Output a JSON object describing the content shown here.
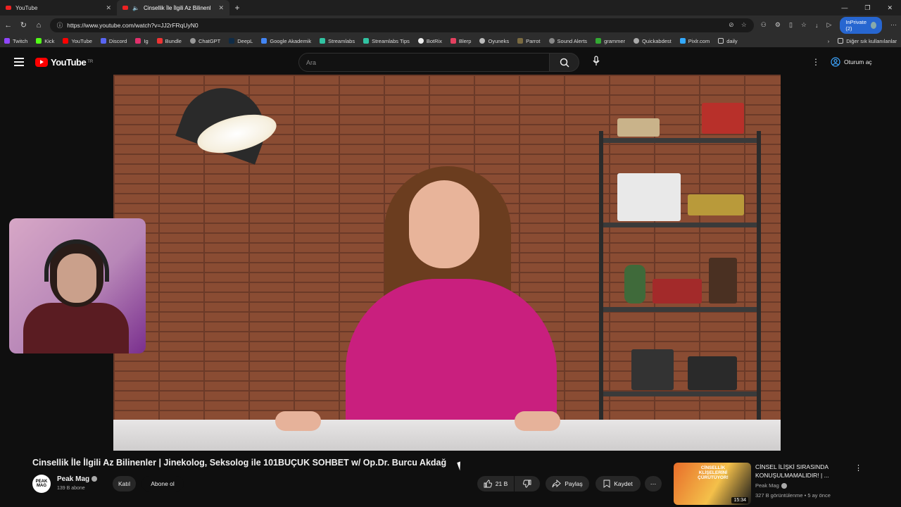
{
  "browser": {
    "tabs": [
      {
        "label": "YouTube"
      },
      {
        "label": "Cinsellik İle İlgili Az Bilinenle"
      }
    ],
    "url": "https://www.youtube.com/watch?v=JJ2rFRqUyN0",
    "inprivate_label": "InPrivate (2)",
    "bookmarks": [
      "Twitch",
      "Kick",
      "YouTube",
      "Discord",
      "Ig",
      "Bundle",
      "ChatGPT",
      "DeepL",
      "Google Akademik",
      "Streamlabs",
      "Streamlabs Tips",
      "BotRix",
      "Blerp",
      "Oyuneks",
      "Parrot",
      "Sound Alerts",
      "grammer",
      "Quickabdest",
      "Pixlr.com",
      "daily"
    ],
    "bookmarks_other": "Diğer sık kullanılanlar"
  },
  "youtube": {
    "logo_text": "YouTube",
    "logo_region": "TR",
    "search_placeholder": "Ara",
    "signin_label": "Oturum aç"
  },
  "video": {
    "title": "Cinsellik İle İlgili Az Bilinenler | Jinekolog, Seksolog ile 101BUÇUK SOHBET w/ Op.Dr. Burcu Akdağ",
    "channel": "Peak Mag",
    "subscribers": "139 B abone",
    "join_label": "Katıl",
    "subscribe_label": "Abone ol",
    "likes": "21 B",
    "share_label": "Paylaş",
    "save_label": "Kaydet",
    "avatar_text": "PEAK MAG"
  },
  "recommended": {
    "title": "CİNSEL İLİŞKİ SIRASINDA KONUŞULMAMALIDIR! | ...",
    "channel": "Peak Mag",
    "meta": "327 B görüntülenme • 5 ay önce",
    "duration": "15:34",
    "thumb_text": "CİNSELLİK KLİŞELERİNİ ÇÜRÜTÜYOR!"
  },
  "colors": {
    "accent": "#ff0000",
    "inprivate": "#2766d0",
    "background": "#0f0f0f"
  }
}
